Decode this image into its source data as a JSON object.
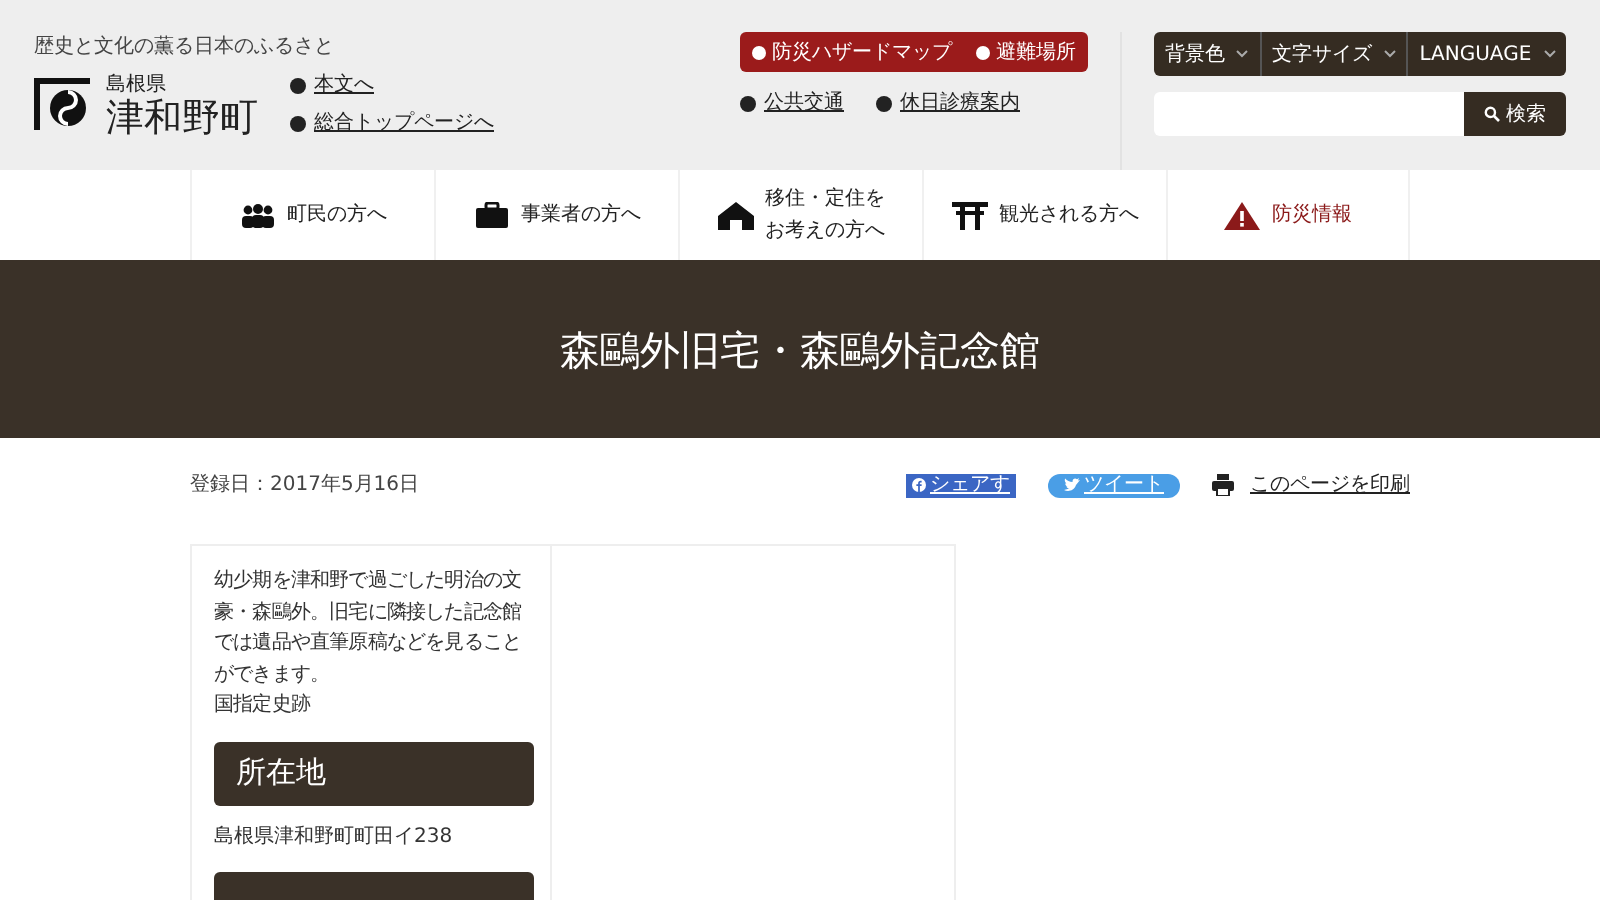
{
  "header": {
    "tagline": "歴史と文化の薫る日本のふるさと",
    "prefecture": "島根県",
    "town": "津和野町",
    "skip_links": [
      "本文へ",
      "総合トップページへ"
    ],
    "disaster_buttons": [
      "防災ハザードマップ",
      "避難場所"
    ],
    "info_links": [
      "公共交通",
      "休日診療案内"
    ],
    "settings": [
      "背景色",
      "文字サイズ",
      "LANGUAGE"
    ],
    "search": {
      "button": "検索"
    }
  },
  "nav": [
    {
      "label": "町民の方へ",
      "kind": "normal"
    },
    {
      "label": "事業者の方へ",
      "kind": "normal"
    },
    {
      "lines": [
        "移住・定住を",
        "お考えの方へ"
      ],
      "kind": "normal"
    },
    {
      "label": "観光される方へ",
      "kind": "normal"
    },
    {
      "label": "防災情報",
      "kind": "alert"
    }
  ],
  "page_title": "森鷗外旧宅・森鷗外記念館",
  "meta": {
    "date": "登録日：2017年5月16日",
    "share": "シェアす",
    "tweet": "ツイート",
    "print": "このページを印刷"
  },
  "content": {
    "description": "幼少期を津和野で過ごした明治の文豪・森鷗外。旧宅に隣接した記念館では遺品や直筆原稿などを見ることができます。",
    "note": "国指定史跡",
    "sections": [
      {
        "heading": "所在地",
        "body": "島根県津和野町町田イ238"
      }
    ]
  }
}
